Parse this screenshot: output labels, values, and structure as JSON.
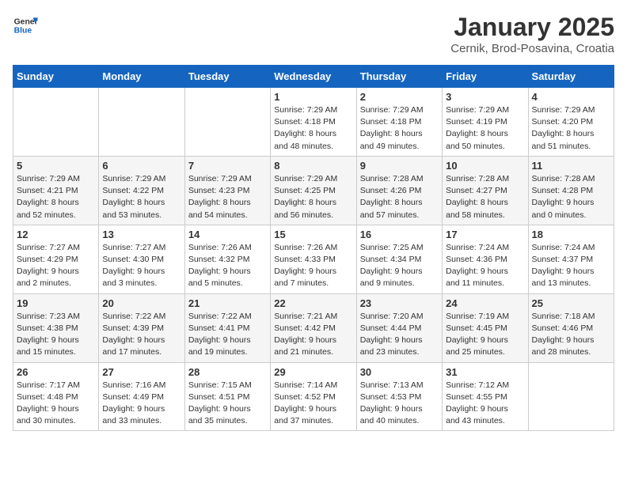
{
  "header": {
    "logo_general": "General",
    "logo_blue": "Blue",
    "title": "January 2025",
    "subtitle": "Cernik, Brod-Posavina, Croatia"
  },
  "weekdays": [
    "Sunday",
    "Monday",
    "Tuesday",
    "Wednesday",
    "Thursday",
    "Friday",
    "Saturday"
  ],
  "weeks": [
    [
      {
        "day": "",
        "info": ""
      },
      {
        "day": "",
        "info": ""
      },
      {
        "day": "",
        "info": ""
      },
      {
        "day": "1",
        "info": "Sunrise: 7:29 AM\nSunset: 4:18 PM\nDaylight: 8 hours\nand 48 minutes."
      },
      {
        "day": "2",
        "info": "Sunrise: 7:29 AM\nSunset: 4:18 PM\nDaylight: 8 hours\nand 49 minutes."
      },
      {
        "day": "3",
        "info": "Sunrise: 7:29 AM\nSunset: 4:19 PM\nDaylight: 8 hours\nand 50 minutes."
      },
      {
        "day": "4",
        "info": "Sunrise: 7:29 AM\nSunset: 4:20 PM\nDaylight: 8 hours\nand 51 minutes."
      }
    ],
    [
      {
        "day": "5",
        "info": "Sunrise: 7:29 AM\nSunset: 4:21 PM\nDaylight: 8 hours\nand 52 minutes."
      },
      {
        "day": "6",
        "info": "Sunrise: 7:29 AM\nSunset: 4:22 PM\nDaylight: 8 hours\nand 53 minutes."
      },
      {
        "day": "7",
        "info": "Sunrise: 7:29 AM\nSunset: 4:23 PM\nDaylight: 8 hours\nand 54 minutes."
      },
      {
        "day": "8",
        "info": "Sunrise: 7:29 AM\nSunset: 4:25 PM\nDaylight: 8 hours\nand 56 minutes."
      },
      {
        "day": "9",
        "info": "Sunrise: 7:28 AM\nSunset: 4:26 PM\nDaylight: 8 hours\nand 57 minutes."
      },
      {
        "day": "10",
        "info": "Sunrise: 7:28 AM\nSunset: 4:27 PM\nDaylight: 8 hours\nand 58 minutes."
      },
      {
        "day": "11",
        "info": "Sunrise: 7:28 AM\nSunset: 4:28 PM\nDaylight: 9 hours\nand 0 minutes."
      }
    ],
    [
      {
        "day": "12",
        "info": "Sunrise: 7:27 AM\nSunset: 4:29 PM\nDaylight: 9 hours\nand 2 minutes."
      },
      {
        "day": "13",
        "info": "Sunrise: 7:27 AM\nSunset: 4:30 PM\nDaylight: 9 hours\nand 3 minutes."
      },
      {
        "day": "14",
        "info": "Sunrise: 7:26 AM\nSunset: 4:32 PM\nDaylight: 9 hours\nand 5 minutes."
      },
      {
        "day": "15",
        "info": "Sunrise: 7:26 AM\nSunset: 4:33 PM\nDaylight: 9 hours\nand 7 minutes."
      },
      {
        "day": "16",
        "info": "Sunrise: 7:25 AM\nSunset: 4:34 PM\nDaylight: 9 hours\nand 9 minutes."
      },
      {
        "day": "17",
        "info": "Sunrise: 7:24 AM\nSunset: 4:36 PM\nDaylight: 9 hours\nand 11 minutes."
      },
      {
        "day": "18",
        "info": "Sunrise: 7:24 AM\nSunset: 4:37 PM\nDaylight: 9 hours\nand 13 minutes."
      }
    ],
    [
      {
        "day": "19",
        "info": "Sunrise: 7:23 AM\nSunset: 4:38 PM\nDaylight: 9 hours\nand 15 minutes."
      },
      {
        "day": "20",
        "info": "Sunrise: 7:22 AM\nSunset: 4:39 PM\nDaylight: 9 hours\nand 17 minutes."
      },
      {
        "day": "21",
        "info": "Sunrise: 7:22 AM\nSunset: 4:41 PM\nDaylight: 9 hours\nand 19 minutes."
      },
      {
        "day": "22",
        "info": "Sunrise: 7:21 AM\nSunset: 4:42 PM\nDaylight: 9 hours\nand 21 minutes."
      },
      {
        "day": "23",
        "info": "Sunrise: 7:20 AM\nSunset: 4:44 PM\nDaylight: 9 hours\nand 23 minutes."
      },
      {
        "day": "24",
        "info": "Sunrise: 7:19 AM\nSunset: 4:45 PM\nDaylight: 9 hours\nand 25 minutes."
      },
      {
        "day": "25",
        "info": "Sunrise: 7:18 AM\nSunset: 4:46 PM\nDaylight: 9 hours\nand 28 minutes."
      }
    ],
    [
      {
        "day": "26",
        "info": "Sunrise: 7:17 AM\nSunset: 4:48 PM\nDaylight: 9 hours\nand 30 minutes."
      },
      {
        "day": "27",
        "info": "Sunrise: 7:16 AM\nSunset: 4:49 PM\nDaylight: 9 hours\nand 33 minutes."
      },
      {
        "day": "28",
        "info": "Sunrise: 7:15 AM\nSunset: 4:51 PM\nDaylight: 9 hours\nand 35 minutes."
      },
      {
        "day": "29",
        "info": "Sunrise: 7:14 AM\nSunset: 4:52 PM\nDaylight: 9 hours\nand 37 minutes."
      },
      {
        "day": "30",
        "info": "Sunrise: 7:13 AM\nSunset: 4:53 PM\nDaylight: 9 hours\nand 40 minutes."
      },
      {
        "day": "31",
        "info": "Sunrise: 7:12 AM\nSunset: 4:55 PM\nDaylight: 9 hours\nand 43 minutes."
      },
      {
        "day": "",
        "info": ""
      }
    ]
  ]
}
